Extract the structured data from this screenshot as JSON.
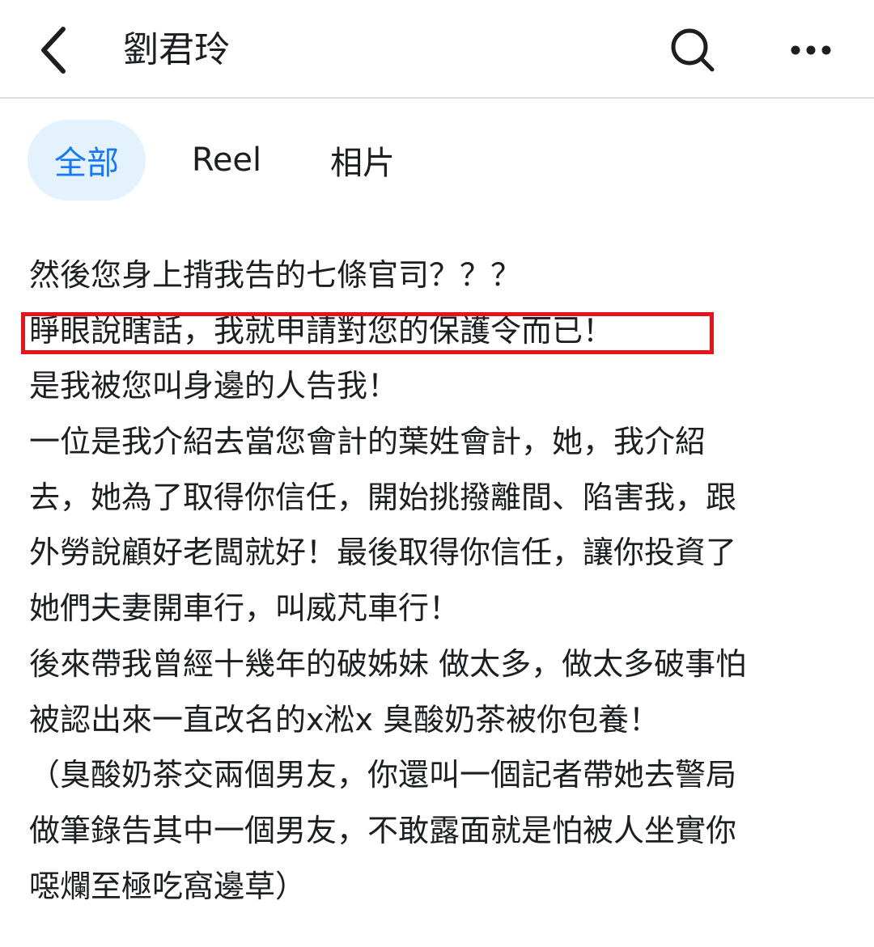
{
  "header": {
    "title": "劉君玲",
    "back_icon": "chevron-left-icon",
    "search_icon": "search-icon",
    "more_icon": "more-horizontal-icon"
  },
  "tabs": [
    {
      "label": "全部",
      "selected": true
    },
    {
      "label": "Reel",
      "selected": false
    },
    {
      "label": "相片",
      "selected": false
    }
  ],
  "colors": {
    "accent": "#1877f2",
    "tab_selected_bg": "#e3f2fd",
    "highlight_border": "#e4141c",
    "text": "#1c1e21",
    "divider": "#dadde1"
  },
  "post": {
    "lines": [
      "然後您身上揹我告的七條官司？？？",
      "睜眼說瞎話，我就申請對您的保護令而已！",
      "是我被您叫身邊的人告我！",
      "一位是我介紹去當您會計的葉姓會計，她，我介紹",
      "去，她為了取得你信任，開始挑撥離間、陷害我，跟",
      "外勞說顧好老闆就好！最後取得你信任，讓你投資了",
      "她們夫妻開車行，叫威芃車行！",
      "後來帶我曾經十幾年的破姊妹 做太多，做太多破事怕",
      "被認出來一直改名的x淞x  臭酸奶茶被你包養！",
      "（臭酸奶茶交兩個男友，你還叫一個記者帶她去警局",
      "做筆錄告其中一個男友，不敢露面就是怕被人坐實你",
      "噁爛至極吃窩邊草）"
    ],
    "highlighted_line": "睜眼說瞎話，我就申請對您的保護令而已！"
  }
}
